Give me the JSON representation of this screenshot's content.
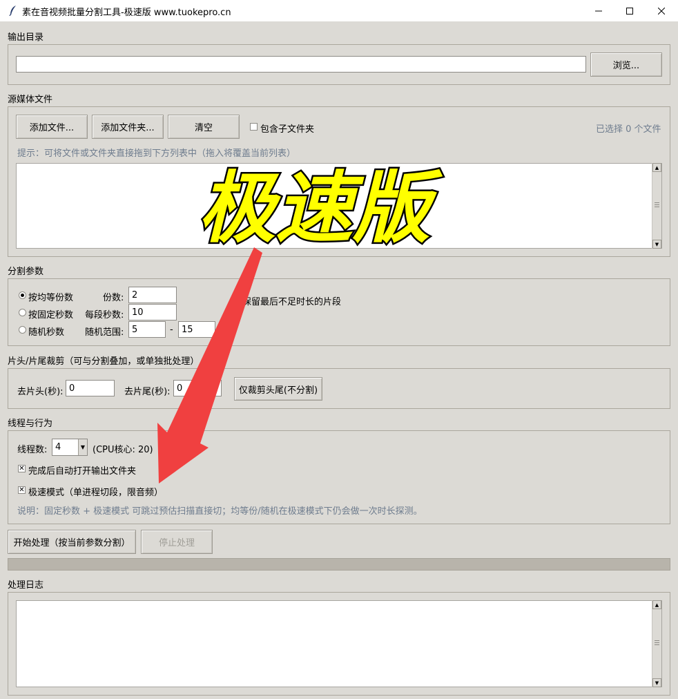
{
  "window": {
    "title": "素在音视频批量分割工具-极速版 www.tuokepro.cn",
    "minimize_glyph": "—",
    "maximize_glyph": "☐",
    "close_glyph": "✕"
  },
  "output": {
    "section_label": "输出目录",
    "path_value": "",
    "browse_label": "浏览..."
  },
  "source": {
    "section_label": "源媒体文件",
    "add_file_label": "添加文件...",
    "add_folder_label": "添加文件夹...",
    "clear_label": "清空",
    "include_sub_label": "包含子文件夹",
    "include_sub_checked": false,
    "selected_count": "已选择 0 个文件",
    "hint": "提示：可将文件或文件夹直接拖到下方列表中（拖入将覆盖当前列表）"
  },
  "split": {
    "section_label": "分割参数",
    "mode_equal_label": "按均等份数",
    "mode_fixed_label": "按固定秒数",
    "mode_random_label": "随机秒数",
    "selected_mode": "equal",
    "parts_label": "份数:",
    "parts_value": "2",
    "seconds_label": "每段秒数:",
    "seconds_value": "10",
    "range_label": "随机范围:",
    "range_min": "5",
    "range_dash": "-",
    "range_max": "15",
    "keep_last_label": "保留最后不足时长的片段"
  },
  "trim": {
    "section_label": "片头/片尾裁剪（可与分割叠加，或单独批处理）",
    "head_label": "去片头(秒):",
    "head_value": "0",
    "tail_label": "去片尾(秒):",
    "tail_value": "0",
    "trim_only_label": "仅裁剪头尾(不分割)"
  },
  "threads": {
    "section_label": "线程与行为",
    "thread_label": "线程数:",
    "thread_value": "4",
    "cpu_info": "(CPU核心: 20)",
    "auto_open_label": "完成后自动打开输出文件夹",
    "auto_open_checked": true,
    "fast_mode_label": "极速模式（单进程切段，限音频）",
    "fast_mode_checked": true,
    "note": "说明：固定秒数 + 极速模式 可跳过预估扫描直接切；均等份/随机在极速模式下仍会做一次时长探测。"
  },
  "actions": {
    "start_label": "开始处理（按当前参数分割）",
    "stop_label": "停止处理",
    "progress_fraction": 0
  },
  "log": {
    "section_label": "处理日志"
  },
  "overlay": {
    "banner_text": "极速版",
    "banner_color": "#ffff00",
    "arrow_color": "#f04040"
  }
}
